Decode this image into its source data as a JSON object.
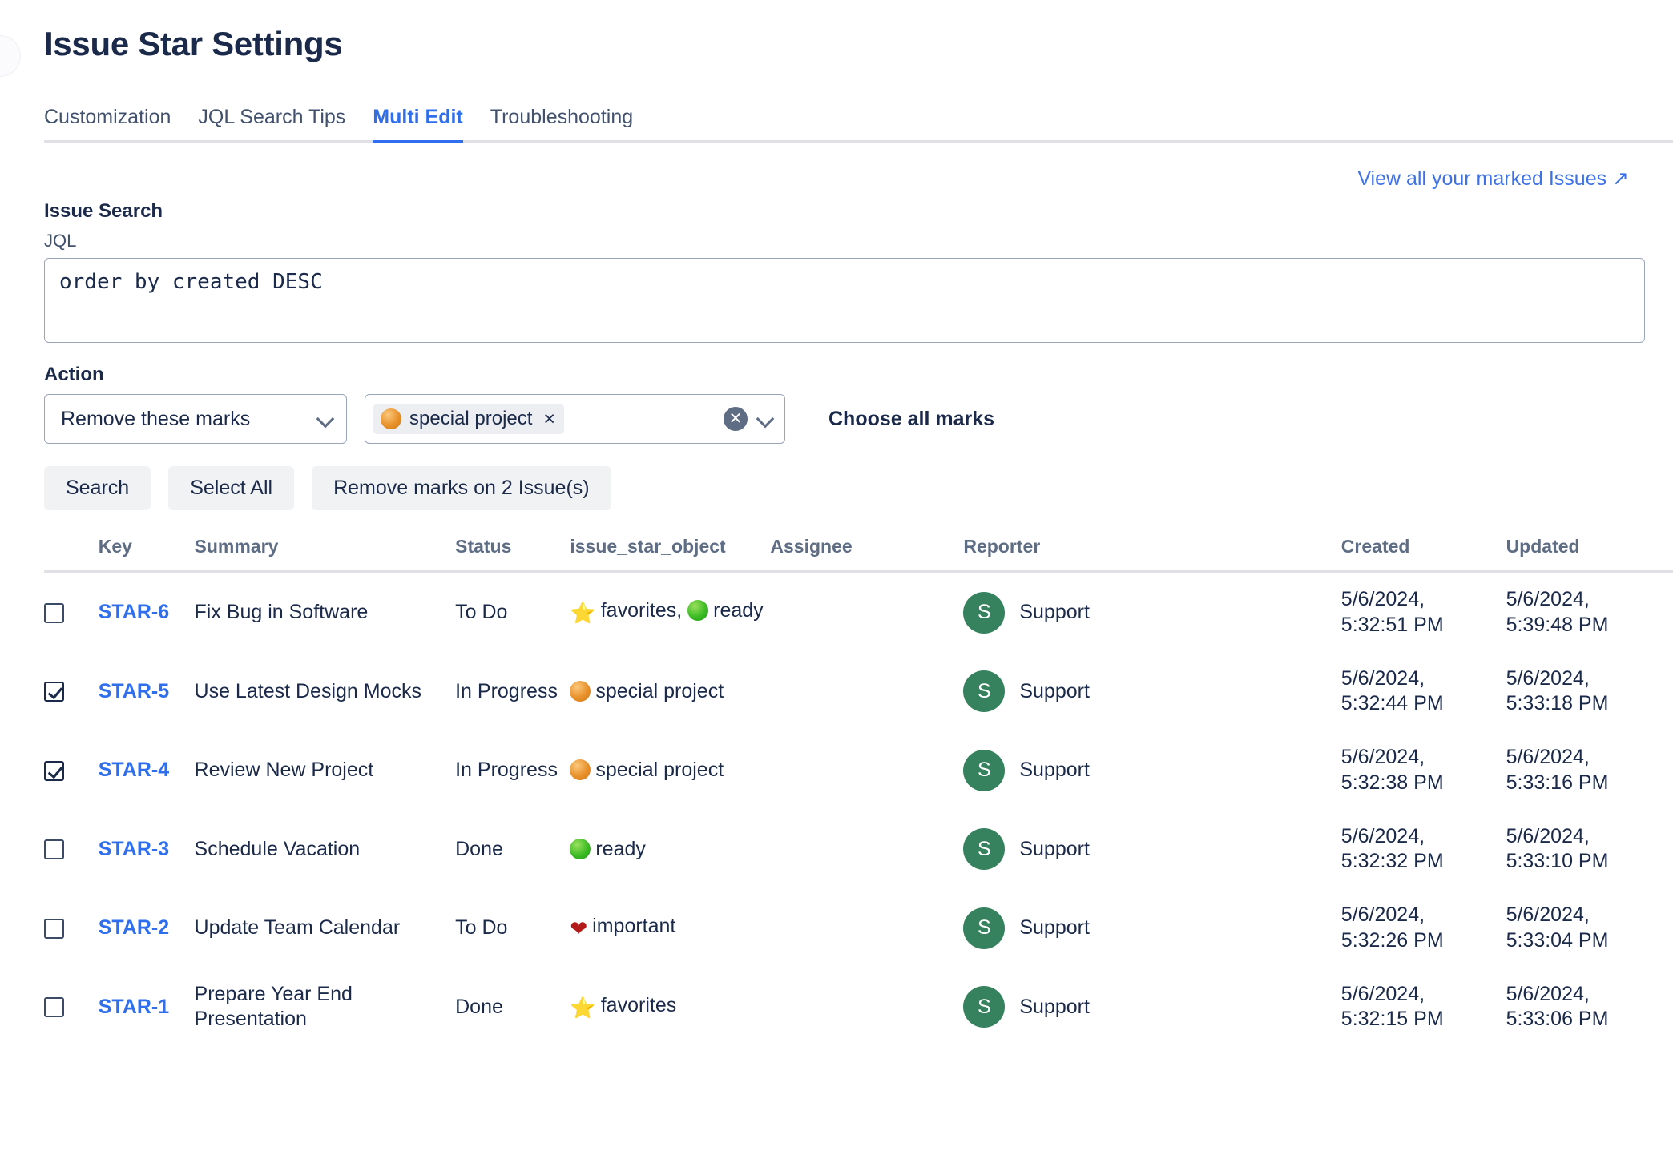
{
  "header": {
    "title": "Issue Star Settings"
  },
  "tabs": [
    {
      "label": "Customization",
      "active": false
    },
    {
      "label": "JQL Search Tips",
      "active": false
    },
    {
      "label": "Multi Edit",
      "active": true
    },
    {
      "label": "Troubleshooting",
      "active": false
    }
  ],
  "top_link": {
    "label": "View all your marked Issues ↗"
  },
  "search": {
    "section_label": "Issue Search",
    "jql_label": "JQL",
    "jql_value": "order by created DESC"
  },
  "action": {
    "label": "Action",
    "select_value": "Remove these marks",
    "select_caret": "chevron-down-icon",
    "tokens": [
      {
        "label": "special project",
        "color": "#e8902a",
        "remove": "×"
      }
    ],
    "clear_icon": "✕",
    "dropdown_caret": "chevron-down-icon",
    "choose_all_label": "Choose all marks"
  },
  "buttons": {
    "search": "Search",
    "select_all": "Select All",
    "remove_marks": "Remove marks on 2 Issue(s)"
  },
  "table": {
    "columns": [
      "",
      "Key",
      "Summary",
      "Status",
      "issue_star_object",
      "Assignee",
      "Reporter",
      "Created",
      "Updated"
    ],
    "rows": [
      {
        "checked": false,
        "key": "STAR-6",
        "summary": "Fix Bug in Software",
        "status": "To Do",
        "marks": [
          {
            "icon": "star-icon",
            "glyph": "⭐",
            "label": "favorites,"
          },
          {
            "icon": "green-circle-icon",
            "glyph": "",
            "label": "ready",
            "color": "green"
          }
        ],
        "assignee": "",
        "reporter": "Support",
        "reporter_initial": "S",
        "created": "5/6/2024,\n5:32:51 PM",
        "updated": "5/6/2024,\n5:39:48 PM"
      },
      {
        "checked": true,
        "key": "STAR-5",
        "summary": "Use Latest Design Mocks",
        "status": "In Progress",
        "marks": [
          {
            "icon": "orange-circle-icon",
            "glyph": "",
            "label": "special project",
            "color": "orange"
          }
        ],
        "assignee": "",
        "reporter": "Support",
        "reporter_initial": "S",
        "created": "5/6/2024,\n5:32:44 PM",
        "updated": "5/6/2024,\n5:33:18 PM"
      },
      {
        "checked": true,
        "key": "STAR-4",
        "summary": "Review New Project",
        "status": "In Progress",
        "marks": [
          {
            "icon": "orange-circle-icon",
            "glyph": "",
            "label": "special project",
            "color": "orange"
          }
        ],
        "assignee": "",
        "reporter": "Support",
        "reporter_initial": "S",
        "created": "5/6/2024,\n5:32:38 PM",
        "updated": "5/6/2024,\n5:33:16 PM"
      },
      {
        "checked": false,
        "key": "STAR-3",
        "summary": "Schedule Vacation",
        "status": "Done",
        "marks": [
          {
            "icon": "green-circle-icon",
            "glyph": "",
            "label": "ready",
            "color": "green"
          }
        ],
        "assignee": "",
        "reporter": "Support",
        "reporter_initial": "S",
        "created": "5/6/2024,\n5:32:32 PM",
        "updated": "5/6/2024,\n5:33:10 PM"
      },
      {
        "checked": false,
        "key": "STAR-2",
        "summary": "Update Team Calendar",
        "status": "To Do",
        "marks": [
          {
            "icon": "heart-icon",
            "glyph": "❤",
            "label": "important"
          }
        ],
        "assignee": "",
        "reporter": "Support",
        "reporter_initial": "S",
        "created": "5/6/2024,\n5:32:26 PM",
        "updated": "5/6/2024,\n5:33:04 PM"
      },
      {
        "checked": false,
        "key": "STAR-1",
        "summary": "Prepare Year End Presentation",
        "status": "Done",
        "marks": [
          {
            "icon": "star-icon",
            "glyph": "⭐",
            "label": "favorites"
          }
        ],
        "assignee": "",
        "reporter": "Support",
        "reporter_initial": "S",
        "created": "5/6/2024,\n5:32:15 PM",
        "updated": "5/6/2024,\n5:33:06 PM"
      }
    ]
  },
  "colors": {
    "accent_blue": "#2f6fed",
    "link_blue": "#3d72e8",
    "text_dark": "#1b2a4a",
    "muted": "#5e6c84",
    "avatar_green": "#36815e",
    "mark_orange": "#e8902a",
    "mark_green": "#3cbb24",
    "mark_red": "#b31b1b"
  }
}
